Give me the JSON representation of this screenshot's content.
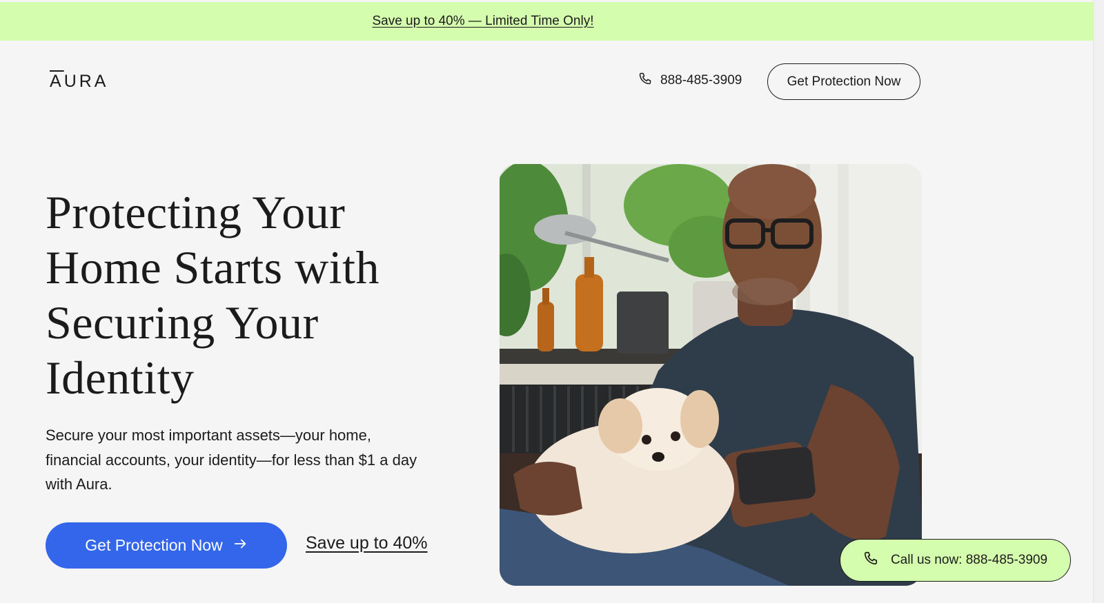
{
  "promo_banner": {
    "text": "Save up to 40% — Limited Time Only!"
  },
  "header": {
    "logo_text": "AURA",
    "logo_overline_letter": "A",
    "logo_rest": "URA",
    "phone": "888-485-3909",
    "cta_label": "Get Protection Now"
  },
  "hero": {
    "title": "Protecting Your Home Starts with Securing Your Identity",
    "subtitle": "Secure your most important assets—your home, financial accounts, your identity—for less than $1 a day with Aura.",
    "primary_cta_label": "Get Protection Now",
    "secondary_link_label": "Save up to 40%",
    "image_icon": "photo-man-with-dog-using-phone"
  },
  "floating_call": {
    "label": "Call us now: 888-485-3909"
  },
  "colors": {
    "banner_bg": "#d5fdae",
    "page_bg": "#f5f5f5",
    "primary_blue": "#3366ea",
    "text": "#1b1b1b"
  }
}
